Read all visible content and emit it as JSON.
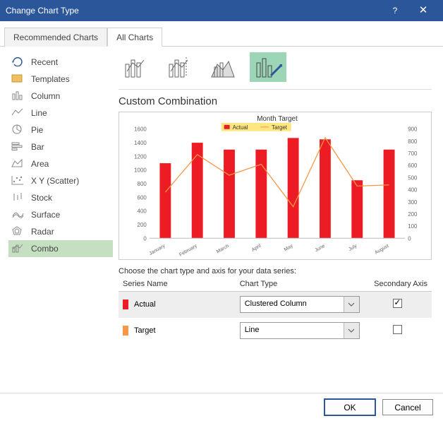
{
  "titlebar": {
    "title": "Change Chart Type",
    "help": "?",
    "close": "✕"
  },
  "tabs": {
    "recommended": "Recommended Charts",
    "all": "All Charts"
  },
  "sidebar": {
    "items": [
      {
        "name": "recent",
        "label": "Recent"
      },
      {
        "name": "templates",
        "label": "Templates"
      },
      {
        "name": "column",
        "label": "Column"
      },
      {
        "name": "line",
        "label": "Line"
      },
      {
        "name": "pie",
        "label": "Pie"
      },
      {
        "name": "bar",
        "label": "Bar"
      },
      {
        "name": "area",
        "label": "Area"
      },
      {
        "name": "scatter",
        "label": "X Y (Scatter)"
      },
      {
        "name": "stock",
        "label": "Stock"
      },
      {
        "name": "surface",
        "label": "Surface"
      },
      {
        "name": "radar",
        "label": "Radar"
      },
      {
        "name": "combo",
        "label": "Combo"
      }
    ]
  },
  "section_title": "Custom Combination",
  "chart_data": {
    "type": "combo",
    "title": "Month Target",
    "legend": [
      {
        "name": "Actual",
        "color": "#ed1c24"
      },
      {
        "name": "Target",
        "color": "#f79646"
      }
    ],
    "categories": [
      "January",
      "February",
      "March",
      "April",
      "May",
      "June",
      "July",
      "August"
    ],
    "series": [
      {
        "name": "Actual",
        "type": "bar",
        "axis": "primary",
        "values": [
          1100,
          1400,
          1300,
          1300,
          1470,
          1450,
          850,
          1300
        ]
      },
      {
        "name": "Target",
        "type": "line",
        "axis": "secondary",
        "values": [
          380,
          690,
          520,
          610,
          260,
          830,
          430,
          440
        ]
      }
    ],
    "ylim_primary": [
      0,
      1600
    ],
    "ylim_secondary": [
      0,
      900
    ],
    "yticks_primary": [
      0,
      200,
      400,
      600,
      800,
      1000,
      1200,
      1400,
      1600
    ],
    "yticks_secondary": [
      0,
      100,
      200,
      300,
      400,
      500,
      600,
      700,
      800,
      900
    ]
  },
  "choose_label": "Choose the chart type and axis for your data series:",
  "series_table": {
    "headers": {
      "name": "Series Name",
      "type": "Chart Type",
      "secondary": "Secondary Axis"
    },
    "rows": [
      {
        "swatch": "#ed1c24",
        "name": "Actual",
        "type": "Clustered Column",
        "secondary": true,
        "selected": true
      },
      {
        "swatch": "#f79646",
        "name": "Target",
        "type": "Line",
        "secondary": false,
        "selected": false
      }
    ]
  },
  "footer": {
    "ok": "OK",
    "cancel": "Cancel"
  }
}
